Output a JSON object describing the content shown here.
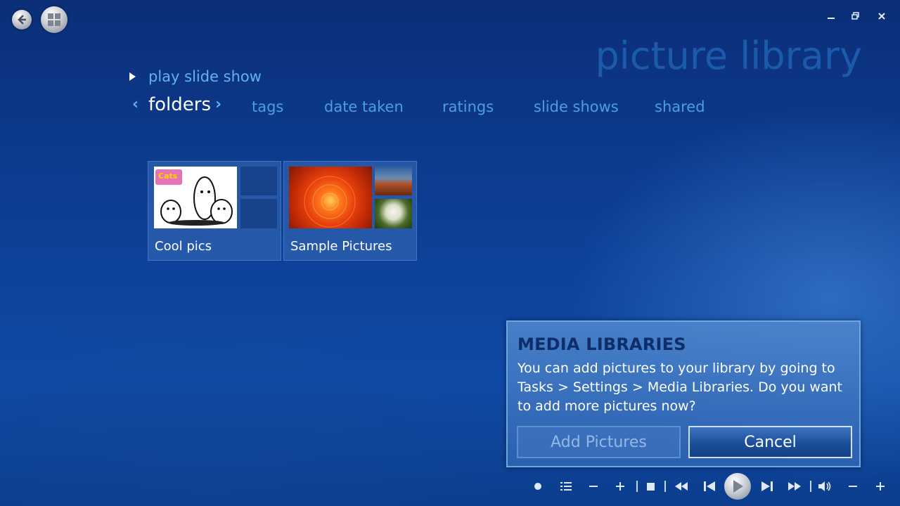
{
  "app": {
    "title": "picture library"
  },
  "menu": {
    "play_slide_show": "play slide show"
  },
  "tabs": [
    {
      "label": "folders",
      "active": true
    },
    {
      "label": "tags"
    },
    {
      "label": "date taken"
    },
    {
      "label": "ratings"
    },
    {
      "label": "slide shows"
    },
    {
      "label": "shared"
    }
  ],
  "folders": [
    {
      "label": "Cool pics",
      "thumb_text": "Cats"
    },
    {
      "label": "Sample Pictures"
    }
  ],
  "dialog": {
    "title": "MEDIA LIBRARIES",
    "message": "You can add pictures to your library by going to Tasks > Settings > Media Libraries. Do you want to add more pictures now?",
    "add_label": "Add Pictures",
    "cancel_label": "Cancel"
  },
  "colors": {
    "accent": "#5fb4ea",
    "dialog_title": "#0d2d6b",
    "background": "#0d3d93"
  }
}
